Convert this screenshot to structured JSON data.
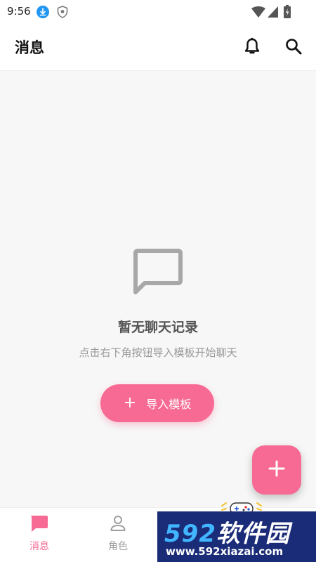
{
  "status_bar": {
    "time": "9:56",
    "icons": [
      "download-icon",
      "shield-icon",
      "wifi-icon",
      "signal-icon",
      "battery-icon"
    ]
  },
  "app_bar": {
    "title": "消息",
    "actions": [
      "bell-icon",
      "search-icon"
    ]
  },
  "empty_state": {
    "icon": "chat-bubble-icon",
    "title": "暂无聊天记录",
    "subtitle": "点击右下角按钮导入模板开始聊天",
    "button_icon": "+",
    "button_label": "导入模板"
  },
  "fab": {
    "icon": "+"
  },
  "bottom_nav": {
    "items": [
      {
        "label": "消息",
        "icon": "message-icon",
        "active": true
      },
      {
        "label": "角色",
        "icon": "person-icon",
        "active": false
      }
    ]
  },
  "watermark": {
    "brand_digits": "592",
    "brand_text": "软件园",
    "url": "www.592xiazai.com"
  },
  "colors": {
    "accent": "#f76a93",
    "background": "#f7f7f7",
    "icon_gray": "#9e9e9e",
    "watermark_bg": "#1a2b78"
  }
}
